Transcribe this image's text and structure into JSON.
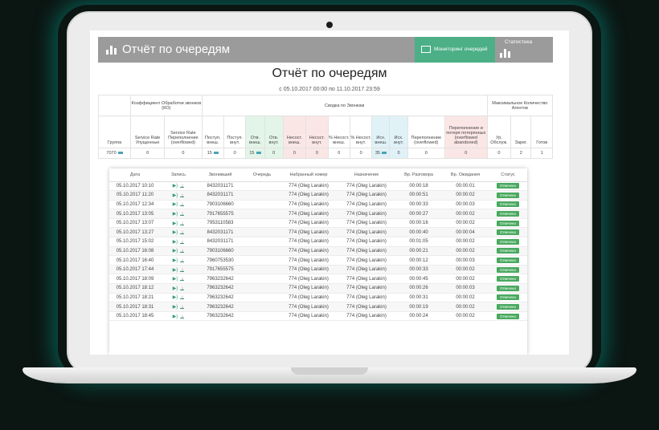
{
  "app": {
    "title": "Отчёт по очередям",
    "nav_monitoring": "Мониторинг очередей",
    "nav_stats": "Статистика"
  },
  "report": {
    "title": "Отчёт по очередям",
    "date_range": "с 05.10.2017 00:00 по 11.10.2017 23:59"
  },
  "summary": {
    "group_headers": {
      "service_level": "Коэффициент Обработки звонков (КО)",
      "calls": "Сводка по Звонкам",
      "agents": "Максимальное Количество Агентов"
    },
    "columns": [
      "Группа",
      "Service Rate Упущенные",
      "Service Rate Переполнение (overflowed)",
      "Поступ. внеш.",
      "Поступ. внут.",
      "Отв. внеш.",
      "Отв. внут.",
      "Несост. внеш.",
      "Несост. внут.",
      "% Несост. внеш.",
      "% Несост. внут.",
      "Исх. внеш.",
      "Исх. внут.",
      "Переполнение (overflowed)",
      "Переполнение и потеря потерянных (overflowed abandoned)",
      "Ур. Обслуж.",
      "Зарег.",
      "Готов"
    ],
    "row": [
      "7070",
      "0",
      "0",
      "15",
      "0",
      "15",
      "0",
      "0",
      "0",
      "0",
      "0",
      "35",
      "0",
      "0",
      "0",
      "0",
      "2",
      "1"
    ]
  },
  "calls": {
    "columns": [
      "Дата",
      "Запись",
      "Звонивший",
      "Очередь",
      "Набранный номер",
      "Назначение",
      "Вр. Разговора",
      "Вр. Ожидания",
      "Статус"
    ],
    "rows": [
      [
        "05.10.2017 10:10",
        "8432031171",
        "774 (Oleg Larakin)",
        "774 (Oleg Larakin)",
        "00:00:18",
        "00:00:01",
        "Отвечено"
      ],
      [
        "05.10.2017 11:20",
        "8432031171",
        "774 (Oleg Larakin)",
        "774 (Oleg Larakin)",
        "00:00:51",
        "00:00:02",
        "Отвечено"
      ],
      [
        "05.10.2017 12:34",
        "7903106660",
        "774 (Oleg Larakin)",
        "774 (Oleg Larakin)",
        "00:00:33",
        "00:00:03",
        "Отвечено"
      ],
      [
        "05.10.2017 13:05",
        "7917655575",
        "774 (Oleg Larakin)",
        "774 (Oleg Larakin)",
        "00:00:27",
        "00:00:02",
        "Отвечено"
      ],
      [
        "05.10.2017 13:07",
        "7953110583",
        "774 (Oleg Larakin)",
        "774 (Oleg Larakin)",
        "00:00:16",
        "00:00:02",
        "Отвечено"
      ],
      [
        "05.10.2017 13:27",
        "8432031171",
        "774 (Oleg Larakin)",
        "774 (Oleg Larakin)",
        "00:00:40",
        "00:00:04",
        "Отвечено"
      ],
      [
        "05.10.2017 15:02",
        "8432031171",
        "774 (Oleg Larakin)",
        "774 (Oleg Larakin)",
        "00:01:05",
        "00:00:02",
        "Отвечено"
      ],
      [
        "05.10.2017 16:08",
        "7903106660",
        "774 (Oleg Larakin)",
        "774 (Oleg Larakin)",
        "00:00:21",
        "00:00:02",
        "Отвечено"
      ],
      [
        "05.10.2017 16:40",
        "7960753530",
        "774 (Oleg Larakin)",
        "774 (Oleg Larakin)",
        "00:00:12",
        "00:00:03",
        "Отвечено"
      ],
      [
        "05.10.2017 17:44",
        "7917655575",
        "774 (Oleg Larakin)",
        "774 (Oleg Larakin)",
        "00:00:33",
        "00:00:02",
        "Отвечено"
      ],
      [
        "05.10.2017 18:09",
        "7963232642",
        "774 (Oleg Larakin)",
        "774 (Oleg Larakin)",
        "00:00:45",
        "00:00:02",
        "Отвечено"
      ],
      [
        "05.10.2017 18:12",
        "7963232642",
        "774 (Oleg Larakin)",
        "774 (Oleg Larakin)",
        "00:00:26",
        "00:00:03",
        "Отвечено"
      ],
      [
        "05.10.2017 18:21",
        "7963232642",
        "774 (Oleg Larakin)",
        "774 (Oleg Larakin)",
        "00:00:31",
        "00:00:02",
        "Отвечено"
      ],
      [
        "05.10.2017 18:31",
        "7963232642",
        "774 (Oleg Larakin)",
        "774 (Oleg Larakin)",
        "00:00:19",
        "00:00:02",
        "Отвечено"
      ],
      [
        "05.10.2017 18:45",
        "7963232642",
        "774 (Oleg Larakin)",
        "774 (Oleg Larakin)",
        "00:00:24",
        "00:00:02",
        "Отвечено"
      ]
    ]
  }
}
